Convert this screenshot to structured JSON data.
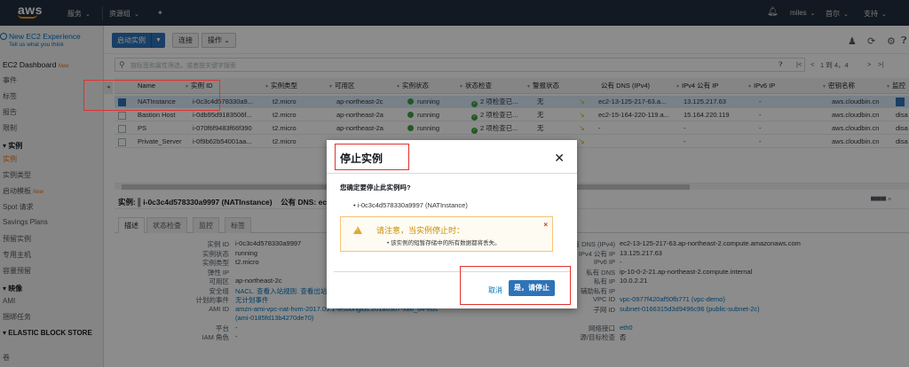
{
  "topnav": {
    "logo": "aws",
    "services": "服务",
    "resource_groups": "资源组",
    "pin_icon": "pin-icon",
    "bell_icon": "bell-icon",
    "user": "miles",
    "region": "首尔",
    "support": "支持"
  },
  "sidebar": {
    "experience_title": "New EC2 Experience",
    "experience_subtitle": "Tell us what you think",
    "dashboard": "EC2 Dashboard",
    "new_badge": "New",
    "items": [
      {
        "label": "事件"
      },
      {
        "label": "标签"
      },
      {
        "label": "报告"
      },
      {
        "label": "限制"
      }
    ],
    "instances_heading": "实例",
    "instances_items": [
      {
        "label": "实例",
        "active": true
      },
      {
        "label": "实例类型"
      },
      {
        "label": "启动模板",
        "badge": "New"
      },
      {
        "label": "Spot 请求"
      },
      {
        "label": "Savings Plans"
      },
      {
        "label": "预留实例"
      },
      {
        "label": "专用主机"
      },
      {
        "label": "容量预留"
      }
    ],
    "images_heading": "映像",
    "images_items": [
      {
        "label": "AMI"
      },
      {
        "label": "捆绑任务"
      }
    ],
    "ebs_heading": "ELASTIC BLOCK STORE",
    "ebs_items": [
      {
        "label": "卷"
      }
    ]
  },
  "toolbar": {
    "launch": "启动实例",
    "connect": "连接",
    "actions": "操作",
    "user_icon": "user-icon",
    "refresh_icon": "refresh-icon",
    "settings_icon": "gear-icon",
    "help_icon": "help-icon"
  },
  "search": {
    "placeholder": "按标签和属性筛选，或者按关键字搜索",
    "pager": "1 到 4，4"
  },
  "table": {
    "headers": [
      "Name",
      "实例 ID",
      "实例类型",
      "可用区",
      "实例状态",
      "状态检查",
      "警报状态",
      "公有 DNS (IPv4)",
      "IPv4 公有 IP",
      "IPv6 IP",
      "密钥名称",
      "监控"
    ],
    "rows": [
      {
        "name": "NATInstance",
        "id": "i-0c3c4d578330a9...",
        "type": "t2.micro",
        "az": "ap-northeast-2c",
        "state": "running",
        "check": "2 项检查已...",
        "alarm": "无",
        "dns": "ec2-13-125-217-63.a...",
        "ipv4": "13.125.217.63",
        "ipv6": "-",
        "key": "aws.cloudbin.cn",
        "mon": "",
        "selected": true
      },
      {
        "name": "Bastion Host",
        "id": "i-0db95d9183506f...",
        "type": "t2.micro",
        "az": "ap-northeast-2a",
        "state": "running",
        "check": "2 项检查已...",
        "alarm": "无",
        "dns": "ec2-15-164-220-119.a...",
        "ipv4": "15.164.220.119",
        "ipv6": "-",
        "key": "aws.cloudbin.cn",
        "mon": "disa",
        "selected": false
      },
      {
        "name": "PS",
        "id": "i-070f6f9483f66f390",
        "type": "t2.micro",
        "az": "ap-northeast-2a",
        "state": "running",
        "check": "2 项检查已...",
        "alarm": "无",
        "dns": "-",
        "ipv4": "-",
        "ipv6": "-",
        "key": "aws.cloudbin.cn",
        "mon": "disa",
        "selected": false
      },
      {
        "name": "Private_Server",
        "id": "i-0f9b62b54001aa...",
        "type": "t2.micro",
        "az": "",
        "state": "",
        "check": "",
        "alarm": "",
        "dns": "",
        "ipv4": "-",
        "ipv6": "-",
        "key": "aws.cloudbin.cn",
        "mon": "disa",
        "selected": false
      }
    ]
  },
  "detail": {
    "header_prefix": "实例:",
    "header_instance": "i-0c3c4d578330a9997 (NATInstance)",
    "header_dns_label": "公有 DNS:",
    "header_dns_value": "ec",
    "tabs": [
      "描述",
      "状态检查",
      "监控",
      "标签"
    ],
    "left": [
      {
        "k": "实例 ID",
        "v": "i-0c3c4d578330a9997"
      },
      {
        "k": "实例状态",
        "v": "running"
      },
      {
        "k": "实例类型",
        "v": "t2.micro"
      },
      {
        "k": "弹性 IP",
        "v": ""
      },
      {
        "k": "可用区",
        "v": "ap-northeast-2c"
      },
      {
        "k": "安全组",
        "v": "NACL. 查看入站规则. 查看出站规则",
        "link": true
      },
      {
        "k": "计划的事件",
        "v": "无计划事件",
        "link": true
      },
      {
        "k": "AMI ID",
        "v": "amzn-ami-vpc-nat-hvm-2017.09.1-testlongids.20180307-x86_64-ebs",
        "link": true
      },
      {
        "k": "",
        "v": "(ami-0185fd13b4270de70)",
        "link": true
      },
      {
        "k": "平台",
        "v": "-"
      },
      {
        "k": "IAM 角色",
        "v": "-"
      }
    ],
    "right": [
      {
        "k": "公有 DNS (IPv4)",
        "v": "ec2-13-125-217-63.ap-northeast-2.compute.amazonaws.com"
      },
      {
        "k": "IPv4 公有 IP",
        "v": "13.125.217.63"
      },
      {
        "k": "IPv6 IP",
        "v": "-"
      },
      {
        "k": "私有 DNS",
        "v": "ip-10-0-2-21.ap-northeast-2.compute.internal"
      },
      {
        "k": "私有 IP",
        "v": "10.0.2.21"
      },
      {
        "k": "辅助私有 IP",
        "v": ""
      },
      {
        "k": "VPC ID",
        "v": "vpc-0977f420af50fb771 (vpc-demo)",
        "link": true
      },
      {
        "k": "子网 ID",
        "v": "subnet-0166315d3d9496c96 (public-subnet-2c)",
        "link": true
      },
      {
        "k": "",
        "v": ""
      },
      {
        "k": "网络接口",
        "v": "eth0",
        "link": true
      },
      {
        "k": "源/目标检查",
        "v": "否"
      }
    ]
  },
  "modal": {
    "title": "停止实例",
    "question": "您确定要停止此实例吗?",
    "instance": "i-0c3c4d578330a9997 (NATInstance)",
    "warning_title": "请注意，当实例停止时：",
    "warning_body": "该实例的短暂存储中的所有数据都将丢失。",
    "cancel": "取消",
    "confirm": "是，请停止"
  },
  "colors": {
    "nav_bg": "#232f3e",
    "primary": "#2e73b8",
    "accent": "#ec7211",
    "annotation": "#e0322f"
  }
}
